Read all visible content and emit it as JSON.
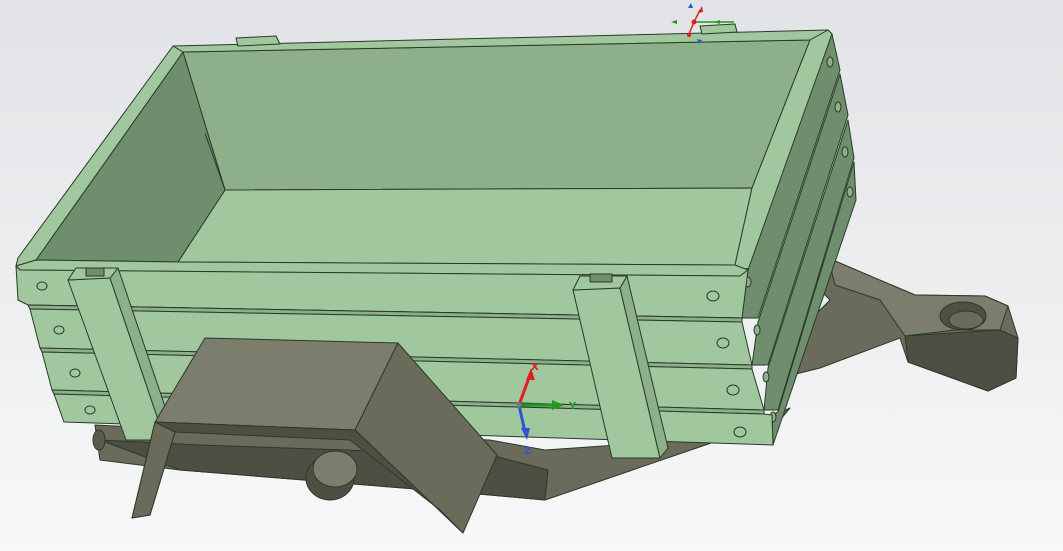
{
  "viewport": {
    "background_top": "#e1e3e6",
    "background_bottom": "#f7f8f9"
  },
  "model": {
    "body_color": "#a1c79f",
    "body_shade": "#8db08b",
    "body_dark": "#6f8e6e",
    "edge_color": "#2a3a28",
    "chassis_color": "#6a6b5b",
    "chassis_dark": "#4e4f42",
    "chassis_light": "#7c7d6c"
  },
  "triad": {
    "x_label": "X",
    "y_label": "Y",
    "z_label": "Z",
    "x_color": "#e02020",
    "y_color": "#1f9a1f",
    "z_color": "#2f55d4"
  },
  "mini_triad": {
    "x_color": "#e02020",
    "y_color": "#1f9a1f",
    "z_color": "#2f55d4"
  }
}
